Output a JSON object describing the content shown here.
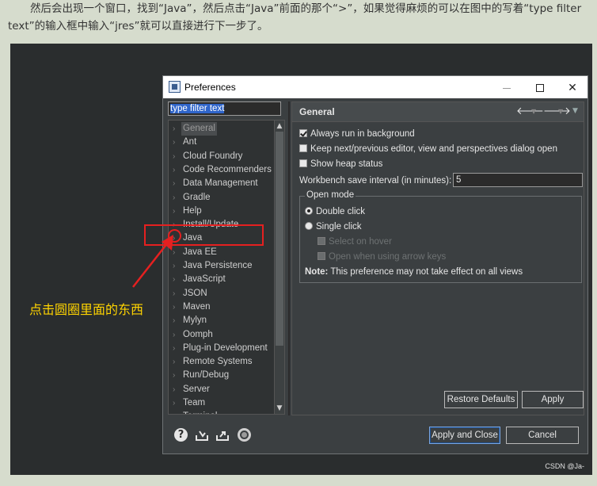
{
  "article": {
    "text": "然后会出现一个窗口，找到“Java”，然后点击“Java”前面的那个“>”，如果觉得麻烦的可以在图中的写着“type filter text”的输入框中输入“jres”就可以直接进行下一步了。"
  },
  "annotation": {
    "label": "点击圆圈里面的东西",
    "color": "#ffd400",
    "highlight_color": "#e52020"
  },
  "watermark": "CSDN @Ja-",
  "dialog": {
    "title": "Preferences",
    "filter": {
      "value": "type filter text"
    },
    "tree": [
      {
        "label": "General",
        "selected": true
      },
      {
        "label": "Ant"
      },
      {
        "label": "Cloud Foundry"
      },
      {
        "label": "Code Recommenders"
      },
      {
        "label": "Data Management"
      },
      {
        "label": "Gradle"
      },
      {
        "label": "Help"
      },
      {
        "label": "Install/Update"
      },
      {
        "label": "Java"
      },
      {
        "label": "Java EE"
      },
      {
        "label": "Java Persistence"
      },
      {
        "label": "JavaScript"
      },
      {
        "label": "JSON"
      },
      {
        "label": "Maven"
      },
      {
        "label": "Mylyn"
      },
      {
        "label": "Oomph"
      },
      {
        "label": "Plug-in Development"
      },
      {
        "label": "Remote Systems"
      },
      {
        "label": "Run/Debug"
      },
      {
        "label": "Server"
      },
      {
        "label": "Team"
      },
      {
        "label": "Terminal"
      }
    ],
    "page": {
      "title": "General",
      "always_run": "Always run in background",
      "keep_next": "Keep next/previous editor, view and perspectives dialog open",
      "show_heap": "Show heap status",
      "interval_label": "Workbench save interval (in minutes):",
      "interval_value": "5",
      "open_mode": {
        "legend": "Open mode",
        "double_click": "Double click",
        "single_click": "Single click",
        "select_on_hover": "Select on hover",
        "open_arrow_keys": "Open when using arrow keys",
        "note_bold": "Note:",
        "note_text": " This preference may not take effect on all views"
      },
      "restore_defaults": "Restore Defaults",
      "apply": "Apply"
    },
    "apply_and_close": "Apply and Close",
    "cancel": "Cancel"
  }
}
